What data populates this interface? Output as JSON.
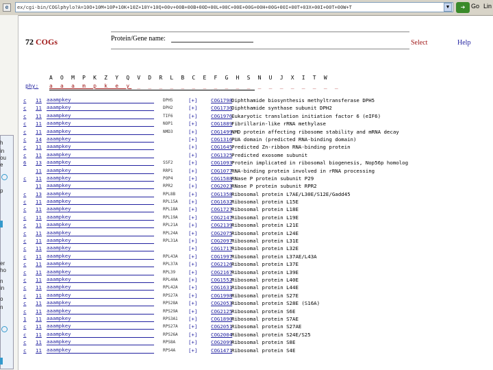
{
  "browser": {
    "address": "ex/cgi-bin/COGlphylo?A=10O+10M+10P+10K+10Z+10Y+10Q+00v+00B+00B+00D+00L+00C+00E+00G+00H+00G+00I+00T+03X+00I+00T+00W+T",
    "go_label": "Go",
    "links_label": "Lin"
  },
  "sidebar": {
    "texts": [
      "h",
      "in",
      "ou",
      "e",
      "p",
      "er",
      "ho",
      "n",
      "in",
      "o",
      "n"
    ]
  },
  "header": {
    "count": "72",
    "cogs": "COGs",
    "search_label": "Protein/Gene name:",
    "search_value": "",
    "select": "Select",
    "help": "Help"
  },
  "phylo": {
    "letters": "A O M P K Z Y Q V D R L B C E F G H S N U J X I T W",
    "label": "phy:",
    "active": "a a a m p k e y",
    "rest": " _ _ _ _ _ _ _ _ _ _ _ _ _ _ _ _ _ _ _"
  },
  "rows": [
    {
      "mark": "c",
      "count": "11",
      "pat": "aaampkey",
      "gene": "DPH5",
      "box": "[+]",
      "cog": "COG1798",
      "desc": "Diphthamide biosynthesis methyltransferase DPH5"
    },
    {
      "mark": "c",
      "count": "11",
      "pat": "aaampkey",
      "gene": "DPH2",
      "box": "[+]",
      "cog": "COG1736",
      "desc": "Diphthamide synthase subunit DPH2"
    },
    {
      "mark": "c",
      "count": "11",
      "pat": "aaampkey",
      "gene": "TIF6",
      "box": "[+]",
      "cog": "COG1976",
      "desc": "Eukaryotic translation initiation factor 6 (eIF6)"
    },
    {
      "mark": "c",
      "count": "11",
      "pat": "aaampkey",
      "gene": "NOP1",
      "box": "[+]",
      "cog": "COG1889",
      "desc": "Fibrillarin-like rRNA methylase"
    },
    {
      "mark": "c",
      "count": "11",
      "pat": "aaampkey",
      "gene": "NMD3",
      "box": "[+]",
      "cog": "COG1499",
      "desc": "NMD protein affecting ribosome stability and mRNA decay"
    },
    {
      "mark": "c",
      "count": "14",
      "pat": "aaampkey",
      "gene": "",
      "box": "[+]",
      "cog": "COG1316",
      "desc": "PUA domain (predicted RNA-binding domain)"
    },
    {
      "mark": "c",
      "count": "11",
      "pat": "aaampkey",
      "gene": "",
      "box": "[+]",
      "cog": "COG1645",
      "desc": "Predicted Zn-ribbon RNA-binding protein"
    },
    {
      "mark": "c",
      "count": "11",
      "pat": "aaampkey",
      "gene": "",
      "box": "[+]",
      "cog": "COG1325",
      "desc": "Predicted exosome subunit"
    },
    {
      "mark": "6",
      "count": "13",
      "pat": "aaampkey",
      "gene": "SSF2",
      "box": "[+]",
      "cog": "COG1093",
      "desc": "Protein implicated in ribosomal biogenesis, Nop56p homolog"
    },
    {
      "mark": "",
      "count": "11",
      "pat": "aaampkey",
      "gene": "RRP1",
      "box": "[+]",
      "cog": "COG1077",
      "desc": "RNA-binding protein involved in rRNA processing"
    },
    {
      "mark": "c",
      "count": "11",
      "pat": "aaampkey",
      "gene": "POP4",
      "box": "[+]",
      "cog": "COG1588",
      "desc": "RNase P protein subunit P29"
    },
    {
      "mark": "",
      "count": "11",
      "pat": "aaampkey",
      "gene": "RPR2",
      "box": "[+]",
      "cog": "COG2023",
      "desc": "RNase P protein subunit RPR2"
    },
    {
      "mark": "c",
      "count": "13",
      "pat": "aaampkey",
      "gene": "RPL8B",
      "box": "[+]",
      "cog": "COG1358",
      "desc": "Ribosomal protein L7AE/L30E/S12E/Gadd45"
    },
    {
      "mark": "c",
      "count": "11",
      "pat": "aaampkey",
      "gene": "RPL15A",
      "box": "[+]",
      "cog": "COG1632",
      "desc": "Ribosomal protein L15E"
    },
    {
      "mark": "c",
      "count": "11",
      "pat": "aaampkey",
      "gene": "RPL18A",
      "box": "[+]",
      "cog": "COG1727",
      "desc": "Ribosomal protein L18E"
    },
    {
      "mark": "c",
      "count": "11",
      "pat": "aaampkey",
      "gene": "RPL19A",
      "box": "[+]",
      "cog": "COG2147",
      "desc": "Ribosomal protein L19E"
    },
    {
      "mark": "c",
      "count": "11",
      "pat": "aaampkey",
      "gene": "RPL21A",
      "box": "[+]",
      "cog": "COG2139",
      "desc": "Ribosomal protein L21E"
    },
    {
      "mark": "c",
      "count": "11",
      "pat": "aaampkey",
      "gene": "RPL24A",
      "box": "[+]",
      "cog": "COG2075",
      "desc": "Ribosomal protein L24E"
    },
    {
      "mark": "c",
      "count": "11",
      "pat": "aaampkey",
      "gene": "RPL31A",
      "box": "[+]",
      "cog": "COG2097",
      "desc": "Ribosomal protein L31E"
    },
    {
      "mark": "c",
      "count": "11",
      "pat": "aaampkey",
      "gene": "",
      "box": "[+]",
      "cog": "COG1717",
      "desc": "Ribosomal protein L32E"
    },
    {
      "mark": "c",
      "count": "11",
      "pat": "aaampkey",
      "gene": "RPL43A",
      "box": "[+]",
      "cog": "COG1997",
      "desc": "Ribosomal protein L37AE/L43A"
    },
    {
      "mark": "c",
      "count": "11",
      "pat": "aaampkey",
      "gene": "RPL37A",
      "box": "[+]",
      "cog": "COG2126",
      "desc": "Ribosomal protein L37E"
    },
    {
      "mark": "c",
      "count": "11",
      "pat": "aaampkey",
      "gene": "RPL39",
      "box": "[+]",
      "cog": "COG2167",
      "desc": "Ribosomal protein L39E"
    },
    {
      "mark": "c",
      "count": "11",
      "pat": "aaampkey",
      "gene": "RPL40A",
      "box": "[+]",
      "cog": "COG1552",
      "desc": "Ribosomal protein L40E"
    },
    {
      "mark": "c",
      "count": "11",
      "pat": "aaampkey",
      "gene": "RPL42A",
      "box": "[+]",
      "cog": "COG1631",
      "desc": "Ribosomal protein L44E"
    },
    {
      "mark": "c",
      "count": "11",
      "pat": "aaampkey",
      "gene": "RPS27A",
      "box": "[+]",
      "cog": "COG1998",
      "desc": "Ribosomal protein S27E"
    },
    {
      "mark": "c",
      "count": "11",
      "pat": "aaampkey",
      "gene": "RPS28A",
      "box": "[+]",
      "cog": "COG2053",
      "desc": "Ribosomal protein S28E (S16A)"
    },
    {
      "mark": "c",
      "count": "11",
      "pat": "aaampkey",
      "gene": "RPS29A",
      "box": "[+]",
      "cog": "COG2125",
      "desc": "Ribosomal protein S6E"
    },
    {
      "mark": "1",
      "count": "11",
      "pat": "aaampkey",
      "gene": "RPS3A1",
      "box": "[+]",
      "cog": "COG1890",
      "desc": "Ribosomal protein S7AE"
    },
    {
      "mark": "c",
      "count": "11",
      "pat": "aaampkey",
      "gene": "RPS27A",
      "box": "[+]",
      "cog": "COG2051",
      "desc": "Ribosomal protein S27AE"
    },
    {
      "mark": "c",
      "count": "11",
      "pat": "aaampkey",
      "gene": "RPS26A",
      "box": "[+]",
      "cog": "COG2004",
      "desc": "Ribosomal protein S24E/S25"
    },
    {
      "mark": "c",
      "count": "11",
      "pat": "aaampkey",
      "gene": "RPS8A",
      "box": "[+]",
      "cog": "COG2099",
      "desc": "Ribosomal protein S8E"
    },
    {
      "mark": "c",
      "count": "11",
      "pat": "aaampkey",
      "gene": "RPS4A",
      "box": "[+]",
      "cog": "COG1471",
      "desc": "Ribosomal protein S4E"
    }
  ]
}
